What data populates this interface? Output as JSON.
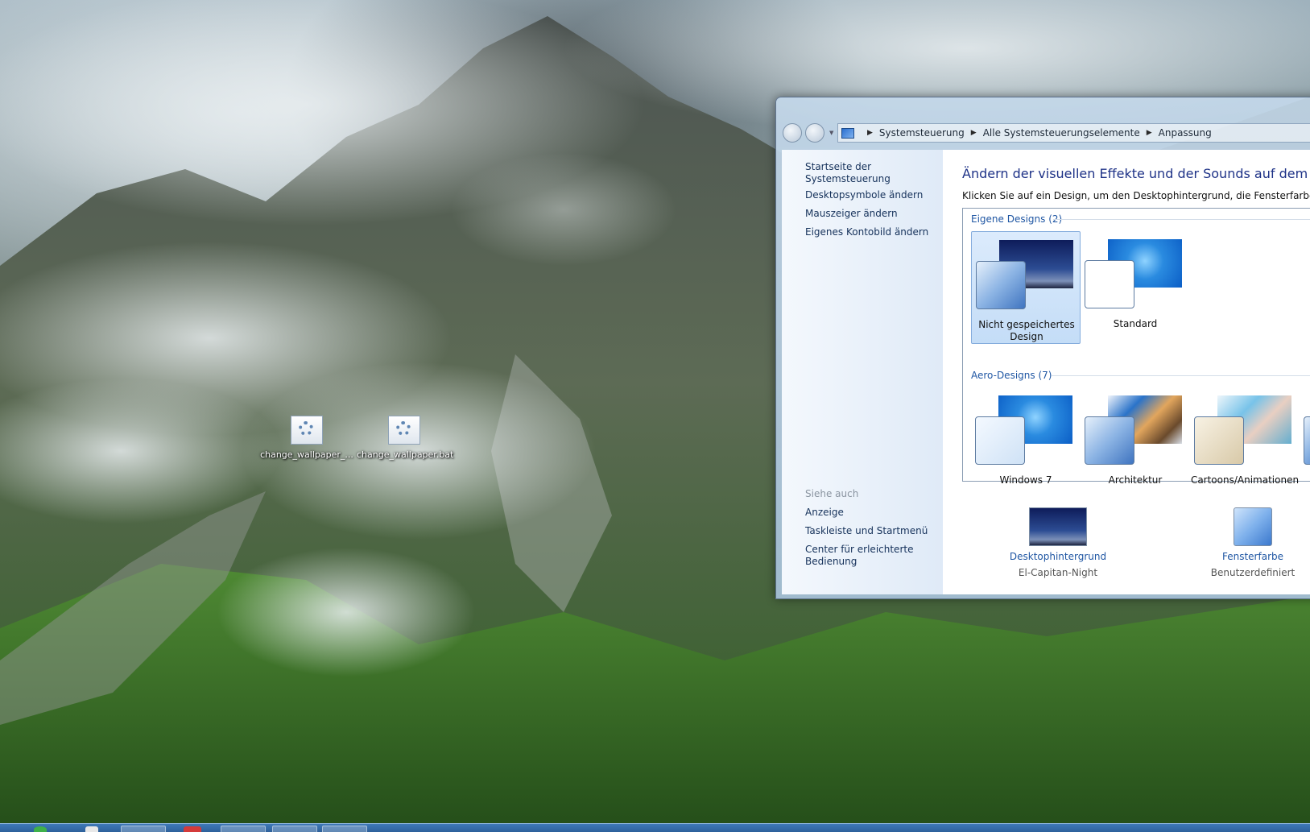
{
  "desktop": {
    "icons": [
      {
        "label": "change_wallpaper_...",
        "icon": "batch-file-icon"
      },
      {
        "label": "change_wallpaper.bat",
        "icon": "batch-file-icon"
      }
    ]
  },
  "window": {
    "breadcrumb": [
      "Systemsteuerung",
      "Alle Systemsteuerungselemente",
      "Anpassung"
    ],
    "sidebar": {
      "home_link": "Startseite der Systemsteuerung",
      "links": [
        "Desktopsymbole ändern",
        "Mauszeiger ändern",
        "Eigenes Kontobild ändern"
      ],
      "see_also_label": "Siehe auch",
      "see_also_links": [
        "Anzeige",
        "Taskleiste und Startmenü",
        "Center für erleichterte Bedienung"
      ]
    },
    "main": {
      "title": "Ändern der visuellen Effekte und der Sounds auf dem Compute",
      "description": "Klicken Sie auf ein Design, um den Desktophintergrund, die Fensterfarbe, die Sound",
      "my_themes_label": "Eigene Designs (2)",
      "my_themes": [
        {
          "name": "Nicht gespeichertes Design",
          "selected": true
        },
        {
          "name": "Standard",
          "selected": false
        }
      ],
      "aero_themes_label": "Aero-Designs (7)",
      "aero_themes": [
        {
          "name": "Windows 7"
        },
        {
          "name": "Architektur"
        },
        {
          "name": "Cartoons/Animationen"
        }
      ],
      "bottom": {
        "background": {
          "title": "Desktophintergrund",
          "value": "El-Capitan-Night"
        },
        "color": {
          "title": "Fensterfarbe",
          "value": "Benutzerdefiniert"
        }
      }
    }
  }
}
